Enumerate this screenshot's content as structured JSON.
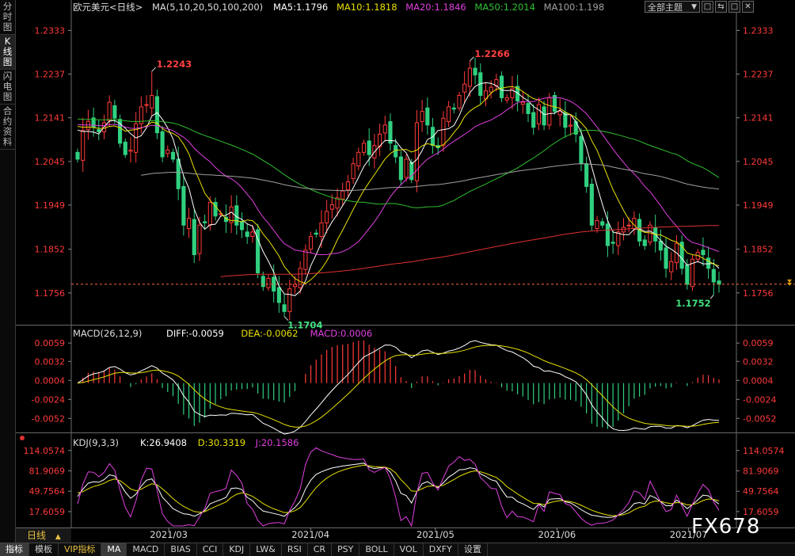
{
  "sidebar": {
    "tabs": [
      "分时图",
      "K线图",
      "闪电图",
      "合约资料"
    ],
    "active": 1
  },
  "header": {
    "symbol_title": "欧元美元<日线>",
    "ma_label": "MA(5,10,20,50,100,200)",
    "ma_values": [
      {
        "label": "MA5:1.1796",
        "color": "#ffffff"
      },
      {
        "label": "MA10:1.1818",
        "color": "#e8e000"
      },
      {
        "label": "MA20:1.1846",
        "color": "#e040e0"
      },
      {
        "label": "MA50:1.2014",
        "color": "#30c030"
      },
      {
        "label": "MA100:1.198",
        "color": "#a0a0a0"
      }
    ],
    "theme_select": "全部主题",
    "window_buttons": [
      "□",
      "⇆",
      "□",
      "✕"
    ]
  },
  "colors": {
    "up": "#ff3a3a",
    "down": "#30d080",
    "axis": "#ff3a3a",
    "price_line": "#ff6a3a",
    "last_price_marker": "#e8a000"
  },
  "chart_data": [
    {
      "type": "candlestick",
      "title": "欧元美元<日线>",
      "ylim": [
        1.17,
        1.2365
      ],
      "y_ticks": [
        "1.2333",
        "1.2237",
        "1.2141",
        "1.2045",
        "1.1949",
        "1.1852",
        "1.1756"
      ],
      "x_labels": [
        "2021/03",
        "2021/04",
        "2021/05",
        "2021/06",
        "2021/07"
      ],
      "current_price": 1.1775,
      "annotations": [
        {
          "text": "1.2243",
          "value": 1.2243,
          "kind": "high"
        },
        {
          "text": "1.1704",
          "value": 1.1704,
          "kind": "low"
        },
        {
          "text": "1.2266",
          "value": 1.2266,
          "kind": "high"
        },
        {
          "text": "1.1752",
          "value": 1.1752,
          "kind": "low"
        }
      ],
      "closes": [
        1.205,
        1.2113,
        1.2133,
        1.212,
        1.211,
        1.213,
        1.2175,
        1.214,
        1.2085,
        1.206,
        1.207,
        1.2128,
        1.2165,
        1.217,
        1.219,
        1.2108,
        1.2055,
        1.207,
        1.205,
        1.1985,
        1.1905,
        1.192,
        1.184,
        1.1905,
        1.191,
        1.1955,
        1.1925,
        1.193,
        1.1913,
        1.1945,
        1.1905,
        1.1895,
        1.188,
        1.189,
        1.18,
        1.177,
        1.1788,
        1.176,
        1.1735,
        1.1715,
        1.1765,
        1.1775,
        1.181,
        1.185,
        1.188,
        1.1885,
        1.191,
        1.1935,
        1.195,
        1.1965,
        1.198,
        1.2,
        1.204,
        1.2065,
        1.2085,
        1.206,
        1.208,
        1.2105,
        1.2125,
        1.2085,
        1.2055,
        1.2005,
        1.205,
        1.2005,
        1.213,
        1.2155,
        1.2125,
        1.208,
        1.2075,
        1.214,
        1.2165,
        1.216,
        1.219,
        1.2215,
        1.225,
        1.2235,
        1.219,
        1.22,
        1.2208,
        1.2225,
        1.2185,
        1.2185,
        1.2205,
        1.2178,
        1.2175,
        1.215,
        1.212,
        1.217,
        1.2125,
        1.2185,
        1.2155,
        1.2155,
        1.212,
        1.2125,
        1.2105,
        1.204,
        1.199,
        1.1905,
        1.1915,
        1.1905,
        1.186,
        1.1865,
        1.189,
        1.19,
        1.1905,
        1.192,
        1.187,
        1.186,
        1.1905,
        1.187,
        1.185,
        1.181,
        1.1825,
        1.1865,
        1.181,
        1.1775,
        1.183,
        1.1845,
        1.184,
        1.181,
        1.178,
        1.1775
      ],
      "series": [
        {
          "name": "MA5",
          "value": "1.1796",
          "color": "#ffffff"
        },
        {
          "name": "MA10",
          "value": "1.1818",
          "color": "#e8e000"
        },
        {
          "name": "MA20",
          "value": "1.1846",
          "color": "#e040e0"
        },
        {
          "name": "MA50",
          "value": "1.2014",
          "color": "#30c030"
        },
        {
          "name": "MA100",
          "value": "1.198",
          "color": "#a0a0a0"
        },
        {
          "name": "MA200",
          "color": "#e03030"
        }
      ]
    },
    {
      "type": "macd",
      "params": "MACD(26,12,9)",
      "values": [
        {
          "label": "DIFF:-0.0059",
          "color": "#ffffff"
        },
        {
          "label": "DEA:-0.0062",
          "color": "#e8e000"
        },
        {
          "label": "MACD:0.0006",
          "color": "#e040e0"
        }
      ],
      "ylim": [
        -0.0068,
        0.0065
      ],
      "y_ticks": [
        "0.0059",
        "0.0032",
        "0.0004",
        "-0.0024",
        "-0.0052"
      ]
    },
    {
      "type": "kdj",
      "params": "KDJ(9,3,3)",
      "values": [
        {
          "label": "K:26.9408",
          "color": "#ffffff"
        },
        {
          "label": "D:30.3319",
          "color": "#e8e000"
        },
        {
          "label": "J:20.1586",
          "color": "#e040e0"
        }
      ],
      "ylim": [
        0,
        125
      ],
      "y_ticks": [
        "114.0574",
        "81.9069",
        "49.7564",
        "17.6059"
      ]
    }
  ],
  "period_label": "日线",
  "bottom_tabs": [
    "指标",
    "模板",
    "VIP指标",
    "MA",
    "MACD",
    "BIAS",
    "CCI",
    "KDJ",
    "LW&",
    "RSI",
    "CR",
    "PSY",
    "BOLL",
    "VOL",
    "DXFY",
    "设置"
  ],
  "bottom_active": [
    "指标",
    "MA"
  ],
  "watermark": "FX678"
}
